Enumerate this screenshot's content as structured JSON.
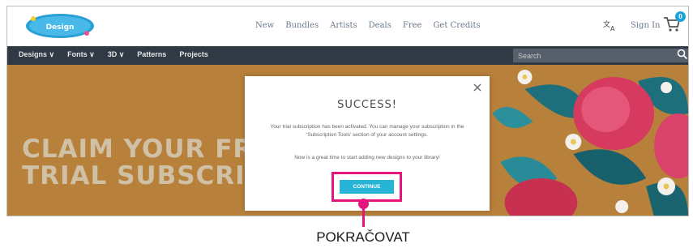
{
  "header": {
    "logo_text": "DesignBundles",
    "nav": [
      "New",
      "Bundles",
      "Artists",
      "Deals",
      "Free",
      "Get Credits"
    ],
    "sign_in": "Sign In",
    "cart_count": "0"
  },
  "subnav": {
    "items": [
      "Designs ∨",
      "Fonts ∨",
      "3D ∨",
      "Patterns",
      "Projects"
    ],
    "search_placeholder": "Search"
  },
  "hero": {
    "line1": "CLAIM YOUR FREE",
    "line2": "TRIAL SUBSCRIPTI"
  },
  "modal": {
    "title": "SUCCESS!",
    "body": "Your trial subscription has been activated. You can manage your subscription in the 'Subscription Tools' section of your account settings.",
    "body2": "Now is a great time to start adding new designs to your library!",
    "continue_label": "CONTINUE"
  },
  "callout": {
    "label": "POKRAČOVAT"
  },
  "colors": {
    "accent_pink": "#e5157d",
    "button_cyan": "#27b4d6",
    "nav_dark": "#2f3a45",
    "badge_blue": "#1ea3d8"
  }
}
